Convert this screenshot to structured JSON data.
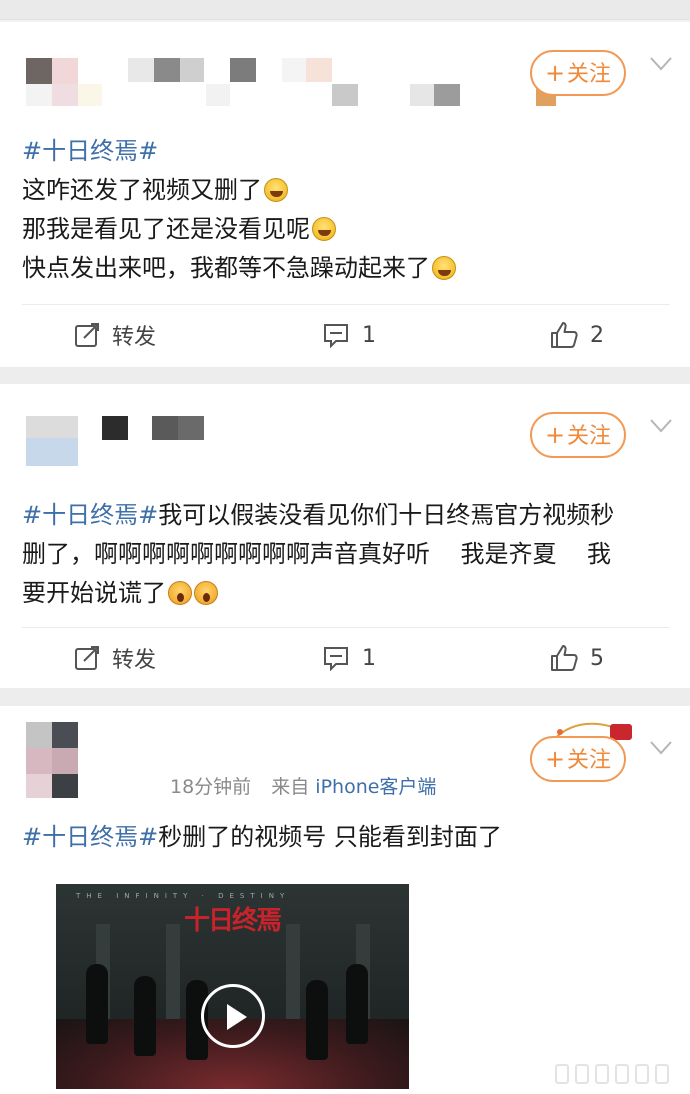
{
  "posts": [
    {
      "follow_label": "关注",
      "follow_plus": "+",
      "hashtag": "#十日终焉#",
      "lines": [
        "这咋还发了视频又删了",
        "那我是看见了还是没看见呢",
        "快点发出来吧，我都等不急躁动起来了"
      ],
      "repost_label": "转发",
      "comment_count": "1",
      "like_count": "2"
    },
    {
      "follow_label": "关注",
      "follow_plus": "+",
      "hashtag": "#十日终焉#",
      "line1_rest": "我可以假装没看见你们十日终焉官方视频秒",
      "line2": "删了，啊啊啊啊啊啊啊啊啊声音真好听    我是齐夏    我",
      "line3": "要开始说谎了",
      "repost_label": "转发",
      "comment_count": "1",
      "like_count": "5"
    },
    {
      "follow_label": "关注",
      "follow_plus": "+",
      "time": "18分钟前",
      "source_prefix": "来自",
      "source": "iPhone客户端",
      "hashtag": "#十日终焉#",
      "text_rest": "秒删了的视频号 只能看到封面了",
      "video_title": "十日终焉",
      "video_subline": "THE INFINITY · DESTINY"
    }
  ],
  "icons": {
    "repost": "share-edit-icon",
    "comment": "comment-icon",
    "like": "thumbs-up-icon",
    "menu": "chevron-down-icon",
    "play": "play-icon"
  },
  "colors": {
    "accent_orange": "#f08a3a",
    "hashtag_blue": "#3e6fa8",
    "text": "#1a1a1a",
    "meta_gray": "#8a8a8a"
  }
}
